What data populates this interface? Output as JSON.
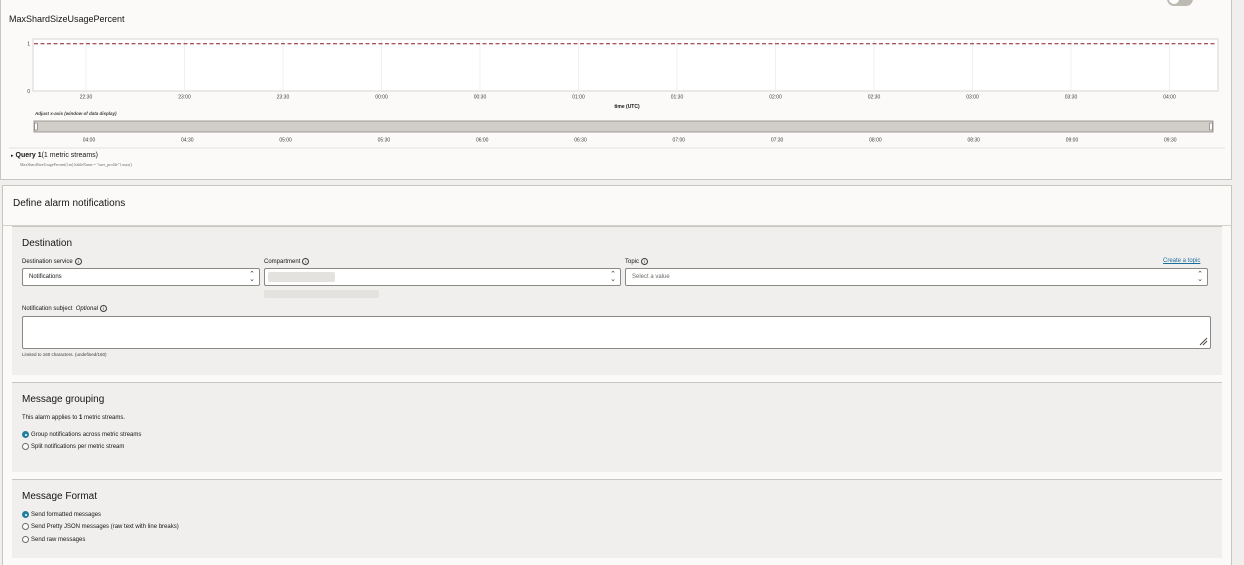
{
  "chart_panel": {
    "title": "MaxShardSizeUsagePercent",
    "range_label": "Adjust x-axis (window of data display)",
    "query_label": "Query 1",
    "query_streams": "(1 metric streams)",
    "query_expression": "MaxShardSizeUsagePercent[1m]{tableName = \"user_profile\"}.max()"
  },
  "chart_data": [
    {
      "type": "line",
      "title": "MaxShardSizeUsagePercent",
      "xlabel": "time (UTC)",
      "ylabel": "",
      "x_ticks": [
        "22:30",
        "23:00",
        "23:30",
        "00:00",
        "00:30",
        "01:00",
        "01:30",
        "02:00",
        "02:30",
        "03:00",
        "03:30",
        "04:00"
      ],
      "y_ticks": [
        "0",
        "1"
      ],
      "ylim": [
        0,
        1.1
      ],
      "series": [
        {
          "line_style": "dashed",
          "color": "#8b1a2e",
          "values": [
            1,
            1,
            1,
            1,
            1,
            1,
            1,
            1,
            1,
            1,
            1,
            1
          ]
        }
      ]
    },
    {
      "type": "area",
      "title": "Adjust x-axis (window of data display)",
      "x_ticks": [
        "04:00",
        "04:30",
        "05:00",
        "05:30",
        "06:00",
        "06:30",
        "07:00",
        "07:30",
        "08:00",
        "08:30",
        "09:00",
        "09:30"
      ]
    }
  ],
  "notifications": {
    "title": "Define alarm notifications",
    "destination": {
      "title": "Destination",
      "service_label": "Destination service",
      "service_value": "Notifications",
      "compartment_label": "Compartment",
      "topic_label": "Topic",
      "topic_placeholder": "Select a value",
      "create_topic": "Create a topic",
      "subject_label": "Notification subject",
      "subject_optional": "Optional",
      "limit_text": "Limited to 160 characters. (undefined/160)"
    },
    "grouping": {
      "title": "Message grouping",
      "applies_prefix": "This alarm applies to ",
      "applies_count": "1",
      "applies_suffix": " metric streams.",
      "options": [
        "Group notifications across metric streams",
        "Split notifications per metric stream"
      ]
    },
    "format": {
      "title": "Message Format",
      "options": [
        "Send formatted messages",
        "Send Pretty JSON messages (raw text with line breaks)",
        "Send raw messages"
      ]
    }
  },
  "colors": {
    "accent": "#227e9e",
    "link": "#1a6e9e",
    "threshold_line": "#8b1a2e"
  }
}
